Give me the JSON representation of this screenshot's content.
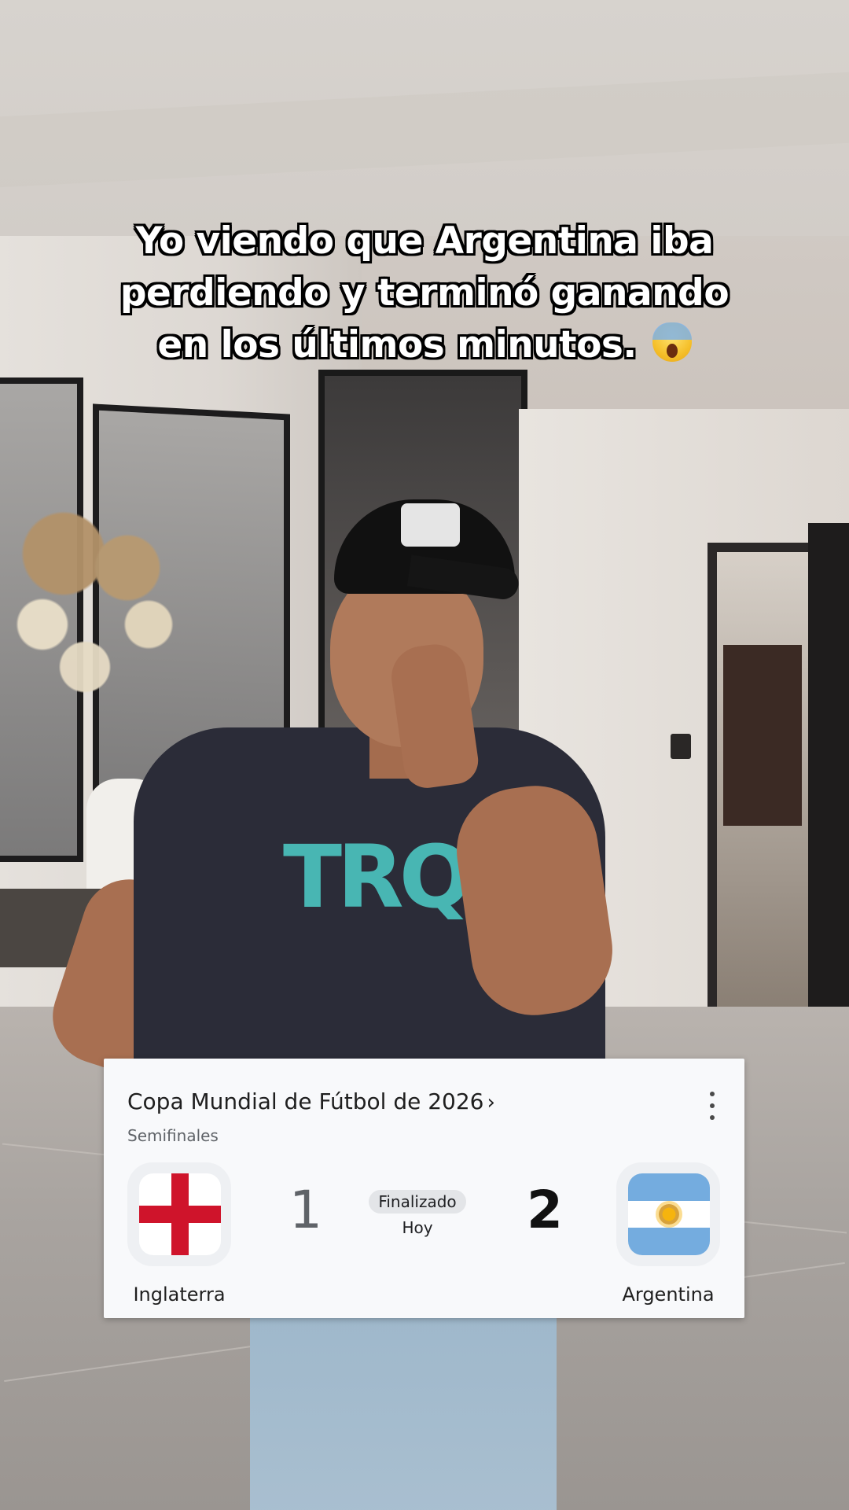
{
  "caption": {
    "text": "Yo viendo que Argentina iba perdiendo y terminó ganando en los últimos minutos.",
    "emoji_name": "screaming-face-emoji"
  },
  "match_card": {
    "competition": "Copa Mundial de Fútbol de 2026",
    "competition_chevron": "›",
    "stage": "Semifinales",
    "status": "Finalizado",
    "date": "Hoy",
    "home": {
      "name": "Inglaterra",
      "score": "1",
      "flag_icon": "england-flag-icon"
    },
    "away": {
      "name": "Argentina",
      "score": "2",
      "flag_icon": "argentina-flag-icon"
    },
    "menu_icon": "more-vert-icon"
  },
  "colors": {
    "card_bg": "#f8f9fb",
    "england_red": "#cf142b",
    "argentina_blue": "#74acdf",
    "argentina_sun": "#f6b40e"
  }
}
